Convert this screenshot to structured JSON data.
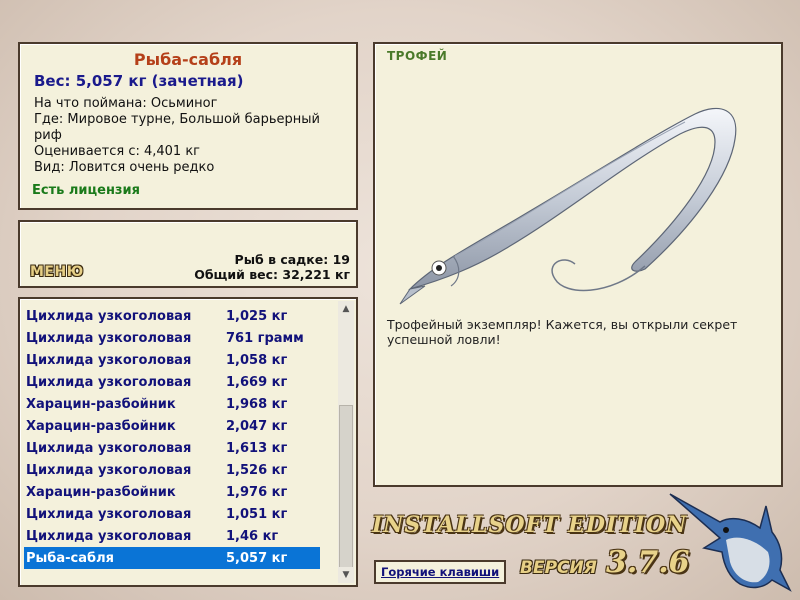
{
  "fish": {
    "name": "Рыба-сабля",
    "weight": "Вес: 5,057 кг (зачетная)",
    "details": [
      "На что поймана: Осьминог",
      "Где: Мировое турне, Большой барьерный риф",
      "Оценивается с: 4,401 кг",
      "Вид: Ловится очень редко"
    ],
    "license": "Есть лицензия"
  },
  "stats": {
    "menu_label": "МЕНЮ",
    "fish_in_keepnet": "Рыб в садке: 19",
    "total_weight": "Общий вес: 32,221 кг"
  },
  "catch_list": {
    "rows": [
      {
        "name": "Цихлида узкоголовая",
        "weight": "1,025 кг"
      },
      {
        "name": "Цихлида узкоголовая",
        "weight": "761 грамм"
      },
      {
        "name": "Цихлида узкоголовая",
        "weight": "1,058 кг"
      },
      {
        "name": "Цихлида узкоголовая",
        "weight": "1,669 кг"
      },
      {
        "name": "Харацин-разбойник",
        "weight": "1,968 кг"
      },
      {
        "name": "Харацин-разбойник",
        "weight": "2,047 кг"
      },
      {
        "name": "Цихлида узкоголовая",
        "weight": "1,613 кг"
      },
      {
        "name": "Цихлида узкоголовая",
        "weight": "1,526 кг"
      },
      {
        "name": "Харацин-разбойник",
        "weight": "1,976 кг"
      },
      {
        "name": "Цихлида узкоголовая",
        "weight": "1,051 кг"
      },
      {
        "name": "Цихлида узкоголовая",
        "weight": "1,46 кг"
      },
      {
        "name": "Рыба-сабля",
        "weight": "5,057 кг",
        "selected": true
      }
    ]
  },
  "trophy": {
    "label": "ТРОФЕЙ",
    "message": "Трофейный экземпляр! Кажется, вы открыли секрет успешной ловли!"
  },
  "footer": {
    "hotkeys": "Горячие клавиши",
    "edition": "INSTALLSOFT EDITION",
    "version_label": "ВЕРСИЯ",
    "version_number": "3.7.6"
  },
  "colors": {
    "panel_bg": "#f4f1dc",
    "panel_border": "#4a3a2c",
    "title": "#b5401a",
    "list_text": "#12127a",
    "selected_row": "#0a74d6",
    "license": "#1a7a1a"
  }
}
